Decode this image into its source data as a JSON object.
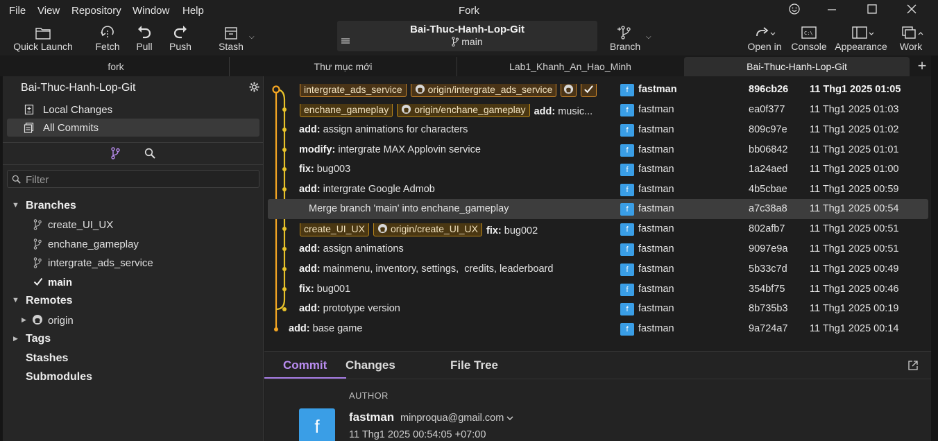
{
  "menubar": {
    "items": [
      "File",
      "View",
      "Repository",
      "Window",
      "Help"
    ],
    "app_title": "Fork"
  },
  "toolbar": {
    "quick_launch": "Quick Launch",
    "fetch": "Fetch",
    "pull": "Pull",
    "push": "Push",
    "stash": "Stash",
    "repo_name": "Bai-Thuc-Hanh-Lop-Git",
    "repo_branch": "main",
    "branch": "Branch",
    "open_in": "Open in",
    "console": "Console",
    "appearance": "Appearance",
    "work": "Work"
  },
  "tabs": [
    {
      "label": "fork"
    },
    {
      "label": "Thư mục mới"
    },
    {
      "label": "Lab1_Khanh_An_Hao_Minh"
    },
    {
      "label": "Bai-Thuc-Hanh-Lop-Git"
    }
  ],
  "sidebar": {
    "repo_title": "Bai-Thuc-Hanh-Lop-Git",
    "local_changes": "Local Changes",
    "all_commits": "All Commits",
    "filter_placeholder": "Filter",
    "branches_header": "Branches",
    "branches": [
      "create_UI_UX",
      "enchane_gameplay",
      "intergrate_ads_service",
      "main"
    ],
    "remotes_header": "Remotes",
    "remotes": [
      "origin"
    ],
    "tags_header": "Tags",
    "stashes_header": "Stashes",
    "submodules_header": "Submodules"
  },
  "commits": [
    {
      "tags": [
        "intergrate_ads_service",
        "origin/intergrate_ads_service"
      ],
      "prefix": "",
      "text": "",
      "author": "fastman",
      "sha": "896cb26",
      "date": "11 Thg1 2025 01:05"
    },
    {
      "tags": [
        "enchane_gameplay",
        "origin/enchane_gameplay"
      ],
      "prefix": "add:",
      "text": " music...",
      "author": "fastman",
      "sha": "ea0f377",
      "date": "11 Thg1 2025 01:03"
    },
    {
      "tags": [],
      "prefix": "add:",
      "text": " assign animations for characters",
      "author": "fastman",
      "sha": "809c97e",
      "date": "11 Thg1 2025 01:02"
    },
    {
      "tags": [],
      "prefix": "modify:",
      "text": " intergrate MAX Applovin service",
      "author": "fastman",
      "sha": "bb06842",
      "date": "11 Thg1 2025 01:01"
    },
    {
      "tags": [],
      "prefix": "fix:",
      "text": " bug003",
      "author": "fastman",
      "sha": "1a24aed",
      "date": "11 Thg1 2025 01:00"
    },
    {
      "tags": [],
      "prefix": "add:",
      "text": " intergrate Google Admob",
      "author": "fastman",
      "sha": "4b5cbae",
      "date": "11 Thg1 2025 00:59"
    },
    {
      "tags": [],
      "prefix": "",
      "text": "Merge branch 'main' into enchane_gameplay",
      "author": "fastman",
      "sha": "a7c38a8",
      "date": "11 Thg1 2025 00:54"
    },
    {
      "tags": [
        "create_UI_UX",
        "origin/create_UI_UX"
      ],
      "prefix": "fix:",
      "text": " bug002",
      "author": "fastman",
      "sha": "802afb7",
      "date": "11 Thg1 2025 00:51"
    },
    {
      "tags": [],
      "prefix": "add:",
      "text": " assign animations",
      "author": "fastman",
      "sha": "9097e9a",
      "date": "11 Thg1 2025 00:51"
    },
    {
      "tags": [],
      "prefix": "add:",
      "text": " mainmenu, inventory, settings,  credits, leaderboard",
      "author": "fastman",
      "sha": "5b33c7d",
      "date": "11 Thg1 2025 00:49"
    },
    {
      "tags": [],
      "prefix": "fix:",
      "text": " bug001",
      "author": "fastman",
      "sha": "354bf75",
      "date": "11 Thg1 2025 00:46"
    },
    {
      "tags": [],
      "prefix": "add:",
      "text": " prototype version",
      "author": "fastman",
      "sha": "8b735b3",
      "date": "11 Thg1 2025 00:19"
    },
    {
      "tags": [],
      "prefix": "add:",
      "text": " base game",
      "author": "fastman",
      "sha": "9a724a7",
      "date": "11 Thg1 2025 00:14"
    }
  ],
  "avatar_letter": "f",
  "detail": {
    "tabs": [
      "Commit",
      "Changes",
      "File Tree"
    ],
    "author_header": "AUTHOR",
    "author_name": "fastman",
    "author_email": "minproqua@gmail.com",
    "author_date": "11 Thg1 2025 00:54:05 +07:00"
  },
  "colors": {
    "accent_purple": "#a77de6",
    "graph_orange": "#f5a623",
    "graph_yellow": "#e8c22a",
    "avatar_blue": "#3a9ee6",
    "tag_border": "#b8861a"
  }
}
